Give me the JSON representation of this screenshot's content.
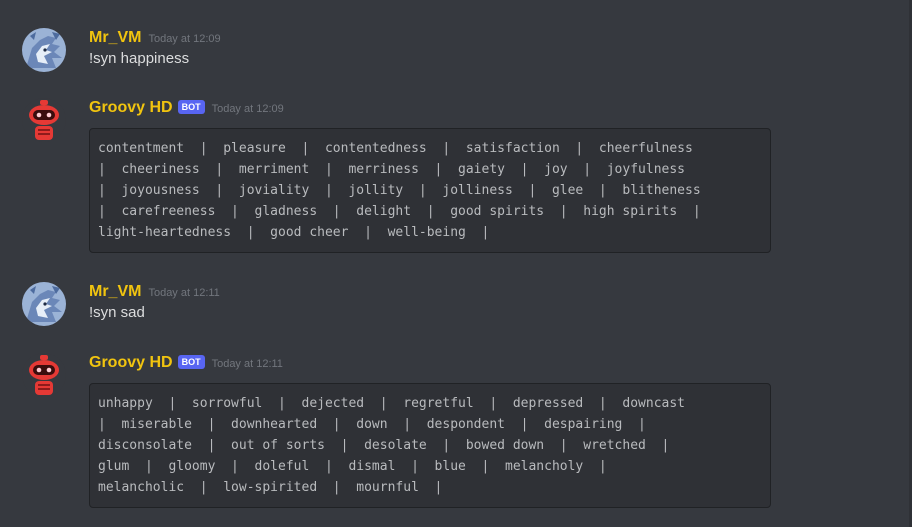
{
  "messages": [
    {
      "username": "Mr_VM",
      "timestamp": "Today at 12:09",
      "text": "!syn happiness",
      "avatar": "dragon-avatar"
    },
    {
      "username": "Groovy HD",
      "badge": "BOT",
      "timestamp": "Today at 12:09",
      "codeblock": "contentment  |  pleasure  |  contentedness  |  satisfaction  |  cheerfulness\n|  cheeriness  |  merriment  |  merriness  |  gaiety  |  joy  |  joyfulness\n|  joyousness  |  joviality  |  jollity  |  jolliness  |  glee  |  blitheness\n|  carefreeness  |  gladness  |  delight  |  good spirits  |  high spirits  |\nlight-heartedness  |  good cheer  |  well-being  |",
      "avatar": "robot-avatar"
    },
    {
      "username": "Mr_VM",
      "timestamp": "Today at 12:11",
      "text": "!syn sad",
      "avatar": "dragon-avatar"
    },
    {
      "username": "Groovy HD",
      "badge": "BOT",
      "timestamp": "Today at 12:11",
      "codeblock": "unhappy  |  sorrowful  |  dejected  |  regretful  |  depressed  |  downcast\n|  miserable  |  downhearted  |  down  |  despondent  |  despairing  |\ndisconsolate  |  out of sorts  |  desolate  |  bowed down  |  wretched  |\nglum  |  gloomy  |  doleful  |  dismal  |  blue  |  melancholy  |\nmelancholic  |  low-spirited  |  mournful  |",
      "avatar": "robot-avatar"
    }
  ],
  "colors": {
    "background": "#36393f",
    "username": "#f1c40f",
    "bot_badge": "#5865f2",
    "codeblock_bg": "#2f3136",
    "timestamp": "#72767d",
    "text": "#dcddde"
  }
}
